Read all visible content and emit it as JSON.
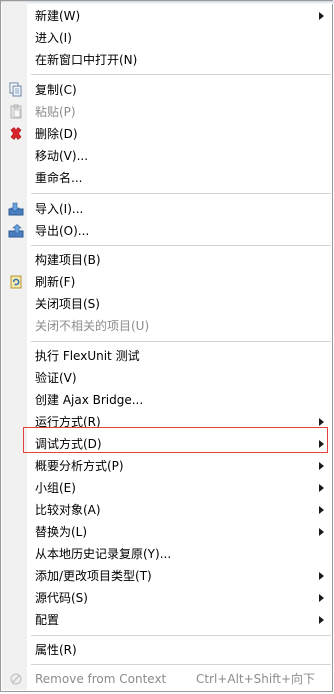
{
  "menu": {
    "items": [
      {
        "label": "新建(W)",
        "submenu": true,
        "disabled": false
      },
      {
        "label": "进入(I)",
        "submenu": false,
        "disabled": false
      },
      {
        "label": "在新窗口中打开(N)",
        "submenu": false,
        "disabled": false
      },
      {
        "label": "复制(C)",
        "submenu": false,
        "disabled": false,
        "icon": "copy-icon"
      },
      {
        "label": "粘贴(P)",
        "submenu": false,
        "disabled": true,
        "icon": "paste-icon"
      },
      {
        "label": "删除(D)",
        "submenu": false,
        "disabled": false,
        "icon": "delete-icon"
      },
      {
        "label": "移动(V)...",
        "submenu": false,
        "disabled": false
      },
      {
        "label": "重命名...",
        "submenu": false,
        "disabled": false
      },
      {
        "label": "导入(I)...",
        "submenu": false,
        "disabled": false,
        "icon": "import-icon"
      },
      {
        "label": "导出(O)...",
        "submenu": false,
        "disabled": false,
        "icon": "export-icon"
      },
      {
        "label": "构建项目(B)",
        "submenu": false,
        "disabled": false
      },
      {
        "label": "刷新(F)",
        "submenu": false,
        "disabled": false,
        "icon": "refresh-icon"
      },
      {
        "label": "关闭项目(S)",
        "submenu": false,
        "disabled": false
      },
      {
        "label": "关闭不相关的项目(U)",
        "submenu": false,
        "disabled": true
      },
      {
        "label": "执行 FlexUnit 测试",
        "submenu": false,
        "disabled": false
      },
      {
        "label": "验证(V)",
        "submenu": false,
        "disabled": false
      },
      {
        "label": "创建 Ajax Bridge...",
        "submenu": false,
        "disabled": false
      },
      {
        "label": "运行方式(R)",
        "submenu": true,
        "disabled": false
      },
      {
        "label": "调试方式(D)",
        "submenu": true,
        "disabled": false
      },
      {
        "label": "概要分析方式(P)",
        "submenu": true,
        "disabled": false
      },
      {
        "label": "小组(E)",
        "submenu": true,
        "disabled": false
      },
      {
        "label": "比较对象(A)",
        "submenu": true,
        "disabled": false
      },
      {
        "label": "替换为(L)",
        "submenu": true,
        "disabled": false
      },
      {
        "label": "从本地历史记录复原(Y)...",
        "submenu": false,
        "disabled": false
      },
      {
        "label": "添加/更改项目类型(T)",
        "submenu": true,
        "disabled": false
      },
      {
        "label": "源代码(S)",
        "submenu": true,
        "disabled": false
      },
      {
        "label": "配置",
        "submenu": true,
        "disabled": false
      },
      {
        "label": "属性(R)",
        "submenu": false,
        "disabled": false
      },
      {
        "label": "Remove from Context",
        "submenu": false,
        "disabled": true,
        "icon": "remove-context-icon",
        "shortcut": "Ctrl+Alt+Shift+向下"
      }
    ],
    "colors": {
      "highlight_border": "#e34040",
      "delete_red": "#d8232a",
      "disabled_text": "#8c8c8c"
    }
  }
}
